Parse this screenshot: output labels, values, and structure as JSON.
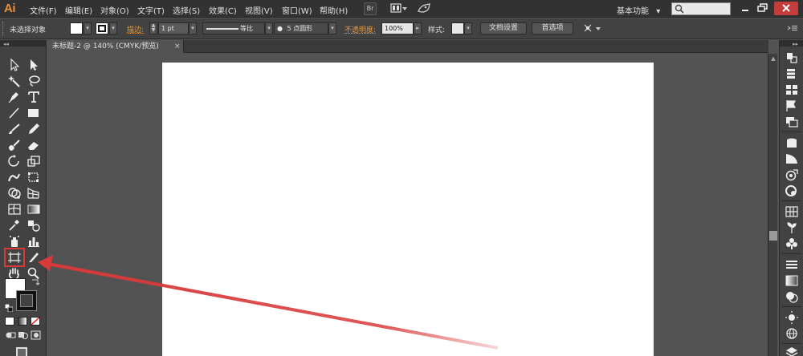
{
  "app": {
    "logo": "Ai"
  },
  "menu": [
    "文件(F)",
    "编辑(E)",
    "对象(O)",
    "文字(T)",
    "选择(S)",
    "效果(C)",
    "视图(V)",
    "窗口(W)",
    "帮助(H)"
  ],
  "menubar": {
    "bridge_label": "Br",
    "workspace": "基本功能",
    "workspace_arrow": "▾"
  },
  "controlbar": {
    "selection_status": "未选择对象",
    "stroke_label": "描边:",
    "stroke_weight": "1 pt",
    "stroke_profile": "等比",
    "brush": "5 点圆形",
    "opacity_label": "不透明度:",
    "opacity": "100%",
    "style_label": "样式:",
    "document_setup": "文档设置",
    "preferences": "首选项"
  },
  "document": {
    "tab_title": "未标题-2 @ 140% (CMYK/预览)",
    "tab_close": "×"
  },
  "tools": [
    "selection-tool",
    "direct-selection-tool",
    "magic-wand-tool",
    "lasso-tool",
    "pen-tool",
    "type-tool",
    "line-segment-tool",
    "rectangle-tool",
    "paintbrush-tool",
    "pencil-tool",
    "blob-brush-tool",
    "eraser-tool",
    "rotate-tool",
    "scale-tool",
    "warp-tool",
    "free-transform-tool",
    "shape-builder-tool",
    "perspective-grid-tool",
    "mesh-tool",
    "gradient-tool",
    "eyedropper-tool",
    "blend-tool",
    "symbol-sprayer-tool",
    "column-graph-tool",
    "artboard-tool",
    "slice-tool",
    "hand-tool",
    "zoom-tool"
  ],
  "colors": {
    "menubar_bg": "#323232",
    "panel_bg": "#424242",
    "workspace_bg": "#535353",
    "logo": "#e8903a",
    "highlight": "#d83a3a",
    "artboard": "#ffffff"
  }
}
